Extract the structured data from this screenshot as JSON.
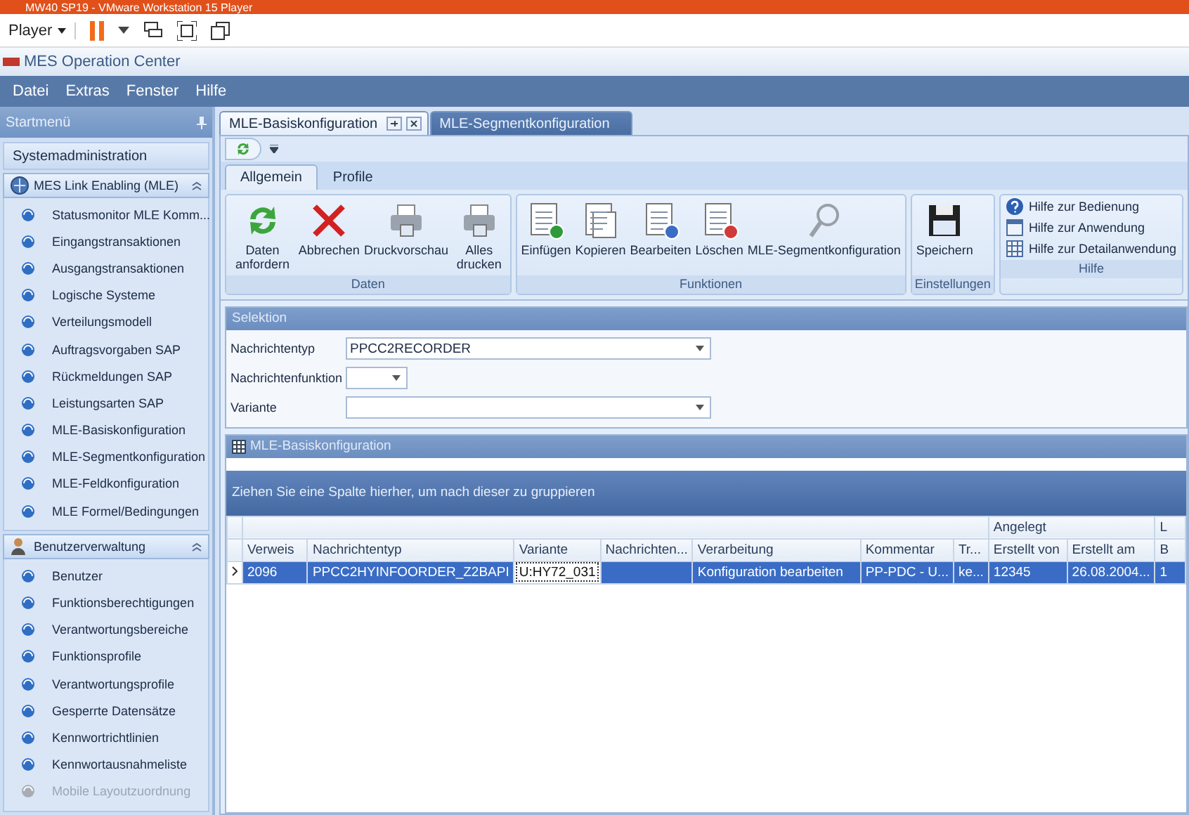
{
  "vm_window": {
    "title": "MW40 SP19 - VMware Workstation 15 Player",
    "player_menu": "Player"
  },
  "app": {
    "title": "MES Operation Center"
  },
  "menu": [
    "Datei",
    "Extras",
    "Fenster",
    "Hilfe"
  ],
  "sidebar": {
    "title": "Startmenü",
    "top_item": "Systemadministration",
    "groups": [
      {
        "kind": "network",
        "label": "MES Link Enabling (MLE)",
        "expanded": true,
        "items": [
          {
            "label": "Statusmonitor MLE Komm...",
            "disabled": false
          },
          {
            "label": "Eingangstransaktionen",
            "disabled": false
          },
          {
            "label": "Ausgangstransaktionen",
            "disabled": false
          },
          {
            "label": "Logische Systeme",
            "disabled": false
          },
          {
            "label": "Verteilungsmodell",
            "disabled": false
          },
          {
            "label": "Auftragsvorgaben SAP",
            "disabled": false
          },
          {
            "label": "Rückmeldungen SAP",
            "disabled": false
          },
          {
            "label": "Leistungsarten SAP",
            "disabled": false
          },
          {
            "label": "MLE-Basiskonfiguration",
            "disabled": false
          },
          {
            "label": "MLE-Segmentkonfiguration",
            "disabled": false
          },
          {
            "label": "MLE-Feldkonfiguration",
            "disabled": false
          },
          {
            "label": "MLE Formel/Bedingungen",
            "disabled": false
          }
        ]
      },
      {
        "kind": "users",
        "label": "Benutzerverwaltung",
        "expanded": true,
        "items": [
          {
            "label": "Benutzer",
            "disabled": false
          },
          {
            "label": "Funktionsberechtigungen",
            "disabled": false
          },
          {
            "label": "Verantwortungsbereiche",
            "disabled": false
          },
          {
            "label": "Funktionsprofile",
            "disabled": false
          },
          {
            "label": "Verantwortungsprofile",
            "disabled": false
          },
          {
            "label": "Gesperrte Datensätze",
            "disabled": false
          },
          {
            "label": "Kennwortrichtlinien",
            "disabled": false
          },
          {
            "label": "Kennwortausnahmeliste",
            "disabled": false
          },
          {
            "label": "Mobile Layoutzuordnung",
            "disabled": true
          }
        ]
      }
    ]
  },
  "document_tabs": [
    {
      "label": "MLE-Basiskonfiguration",
      "selected": true
    },
    {
      "label": "MLE-Segmentkonfiguration",
      "selected": false
    }
  ],
  "ribbon": {
    "tabs": [
      {
        "label": "Allgemein",
        "selected": true
      },
      {
        "label": "Profile",
        "selected": false
      }
    ],
    "groups": [
      {
        "label": "Daten",
        "buttons": [
          {
            "kind": "refresh",
            "label": "Daten anfordern"
          },
          {
            "kind": "cancel",
            "label": "Abbrechen"
          },
          {
            "kind": "print",
            "label": "Druckvorschau"
          },
          {
            "kind": "print",
            "label": "Alles drucken"
          }
        ]
      },
      {
        "label": "Funktionen",
        "buttons": [
          {
            "kind": "add",
            "label": "Einfügen"
          },
          {
            "kind": "copy",
            "label": "Kopieren"
          },
          {
            "kind": "edit",
            "label": "Bearbeiten"
          },
          {
            "kind": "delete",
            "label": "Löschen"
          },
          {
            "kind": "search",
            "label": "MLE-Segmentkonfiguration"
          }
        ]
      },
      {
        "label": "Einstellungen",
        "buttons": [
          {
            "kind": "save",
            "label": "Speichern"
          }
        ]
      },
      {
        "label": "Hilfe",
        "buttons": [
          {
            "kind": "help",
            "label": "Hilfe zur Bedienung"
          },
          {
            "kind": "window",
            "label": "Hilfe zur Anwendung"
          },
          {
            "kind": "grid",
            "label": "Hilfe zur Detailanwendung"
          }
        ]
      }
    ]
  },
  "selection": {
    "title": "Selektion",
    "fields": [
      {
        "kind": "wide",
        "label": "Nachrichtentyp",
        "value": "PPCC2RECORDER"
      },
      {
        "kind": "narrow",
        "label": "Nachrichtenfunktion"
      },
      {
        "kind": "wide",
        "label": "Variante"
      }
    ]
  },
  "grid": {
    "title": "MLE-Basiskonfiguration",
    "group_hint": "Ziehen Sie eine Spalte hierher, um nach dieser zu gruppieren",
    "bands": [
      "Angelegt",
      "L"
    ],
    "columns": [
      "Verweis",
      "Nachrichtentyp",
      "Variante",
      "Nachrichten...",
      "Verarbeitung",
      "Kommentar",
      "Tr...",
      "Erstellt von",
      "Erstellt am",
      "B"
    ],
    "rows": [
      {
        "selected": true,
        "cells": [
          {
            "text": "2096",
            "focused": false
          },
          {
            "text": "PPCC2HYINFOORDER_Z2BAPI",
            "focused": false
          },
          {
            "text": "U:HY72_031",
            "focused": true
          },
          {
            "text": "",
            "focused": false
          },
          {
            "text": "Konfiguration bearbeiten",
            "focused": false
          },
          {
            "text": "PP-PDC - U...",
            "focused": false
          },
          {
            "text": "ke...",
            "focused": false
          },
          {
            "text": "12345",
            "focused": false
          },
          {
            "text": "26.08.2004...",
            "focused": false
          },
          {
            "text": "1",
            "focused": false
          }
        ]
      }
    ]
  }
}
